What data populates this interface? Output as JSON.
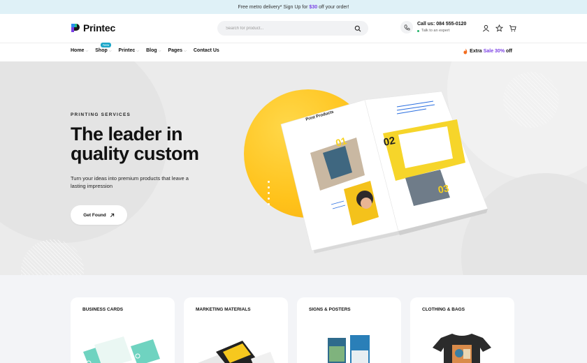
{
  "topbar": {
    "pre": "Free metro delivery* Sign Up for",
    "amount": "$30",
    "post": "off your order!"
  },
  "header": {
    "brand": "Printec",
    "search_placeholder": "Search for product...",
    "call_label": "Call us: 084 555-0120",
    "talk_label": "Talk to an expert"
  },
  "nav": {
    "items": [
      {
        "label": "Home"
      },
      {
        "label": "Shop",
        "badge": "New"
      },
      {
        "label": "Printec"
      },
      {
        "label": "Blog"
      },
      {
        "label": "Pages"
      },
      {
        "label": "Contact Us"
      }
    ],
    "promo_pre": "Extra",
    "promo_sale": "Sale 30%",
    "promo_post": "off"
  },
  "hero": {
    "eyebrow": "PRINTING SERVICES",
    "title": "The leader in quality custom",
    "subtitle": "Turn your ideas into premium products that leave a lasting impression",
    "cta_label": "Get Found",
    "book": {
      "heading": "Print Products",
      "num1": "01",
      "num2": "02",
      "num3": "03"
    }
  },
  "categories": [
    {
      "title": "BUSINESS CARDS"
    },
    {
      "title": "MARKETING MATERIALS"
    },
    {
      "title": "SIGNS & POSTERS"
    },
    {
      "title": "CLOTHING & BAGS"
    }
  ],
  "colors": {
    "accent": "#7a3fe4",
    "hero_yellow": "#ffc21a",
    "badge": "#1aa6c8"
  }
}
